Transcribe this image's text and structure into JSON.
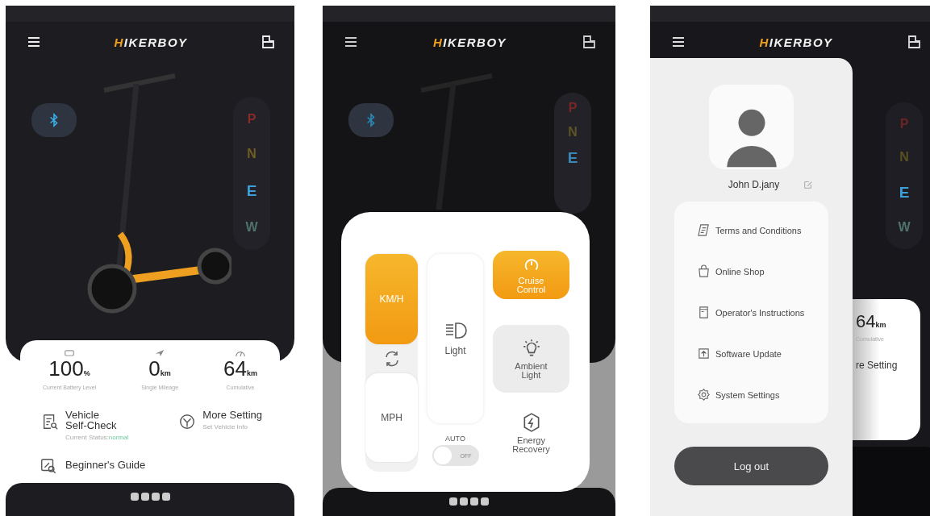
{
  "screens": [
    {
      "kind": "home",
      "logo": "HIKERBOY",
      "gears": [
        {
          "label": "P",
          "color": "#8a2b2b",
          "selected": false
        },
        {
          "label": "N",
          "color": "#6e5e24",
          "selected": false
        },
        {
          "label": "E",
          "color": "#3d9fd8",
          "selected": true
        },
        {
          "label": "W",
          "color": "#4f736c",
          "selected": false
        }
      ],
      "stats": [
        {
          "value": "100",
          "unit": "%",
          "label": "Current Battery Level"
        },
        {
          "value": "0",
          "unit": "km",
          "label": "Single Mileage"
        },
        {
          "value": "64",
          "unit": "km",
          "label": "Cumulative"
        }
      ],
      "actions": [
        {
          "title": "Vehicle Self-Check",
          "subtitle": "Current Status:",
          "status": "normal"
        },
        {
          "title": "More Setting",
          "subtitle": "Set Vehicle Info"
        }
      ],
      "guide": "Beginner's Guide"
    },
    {
      "kind": "controls",
      "logo": "HIKERBOY",
      "gears": [
        {
          "label": "P",
          "color": "#7a2626",
          "selected": false
        },
        {
          "label": "N",
          "color": "#5e5424",
          "selected": false
        },
        {
          "label": "E",
          "color": "#3a88b8",
          "selected": true
        }
      ],
      "units": [
        {
          "label": "KM/H",
          "selected": true
        },
        {
          "label": "MPH",
          "selected": false
        }
      ],
      "light": "Light",
      "auto": {
        "label": "AUTO",
        "state": "OFF",
        "on": false
      },
      "tiles": [
        {
          "label": "Cruise Control",
          "on": true,
          "pressed": false
        },
        {
          "label": "Ambient Light",
          "on": false,
          "pressed": true
        },
        {
          "label": "Energy Recovery",
          "on": false,
          "pressed": false
        }
      ]
    },
    {
      "kind": "menu",
      "logo": "HIKERBOY",
      "gears": [
        {
          "label": "P",
          "color": "#6e2424",
          "selected": false
        },
        {
          "label": "N",
          "color": "#5a5022",
          "selected": false
        },
        {
          "label": "E",
          "color": "#3d9fd8",
          "selected": true
        },
        {
          "label": "W",
          "color": "#4f736c",
          "selected": false
        }
      ],
      "user": "John D.jany",
      "items": [
        {
          "label": "Terms and Conditions"
        },
        {
          "label": "Online Shop"
        },
        {
          "label": "Operator's Instructions"
        },
        {
          "label": "Software Update"
        },
        {
          "label": "System Settings"
        }
      ],
      "logout": "Log out",
      "peek": {
        "value": "64",
        "unit": "km",
        "label": "Cumulative",
        "setting": "re Setting"
      }
    }
  ]
}
